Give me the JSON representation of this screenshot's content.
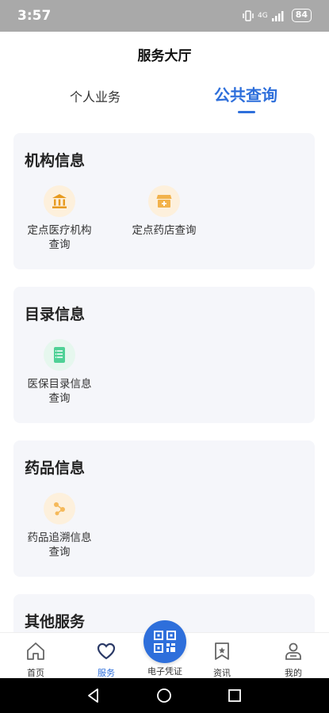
{
  "status": {
    "time": "3:57",
    "network": "4G",
    "battery": "84"
  },
  "header": {
    "title": "服务大厅"
  },
  "tabs": [
    {
      "label": "个人业务",
      "active": false
    },
    {
      "label": "公共查询",
      "active": true
    }
  ],
  "cards": [
    {
      "title": "机构信息",
      "items": [
        {
          "label1": "定点医疗机构",
          "label2": "查询",
          "icon": "bank-icon"
        },
        {
          "label1": "定点药店查询",
          "label2": "",
          "icon": "store-icon"
        }
      ]
    },
    {
      "title": "目录信息",
      "items": [
        {
          "label1": "医保目录信息",
          "label2": "查询",
          "icon": "list-icon"
        }
      ]
    },
    {
      "title": "药品信息",
      "items": [
        {
          "label1": "药品追溯信息",
          "label2": "查询",
          "icon": "trace-icon"
        }
      ]
    },
    {
      "title": "其他服务",
      "items": []
    }
  ],
  "tabbar": {
    "home": "首页",
    "service": "服务",
    "credential": "电子凭证",
    "news": "资讯",
    "mine": "我的"
  },
  "colors": {
    "accent": "#2e6fdb",
    "orange": "#f5a623",
    "green": "#3ecf8e"
  }
}
